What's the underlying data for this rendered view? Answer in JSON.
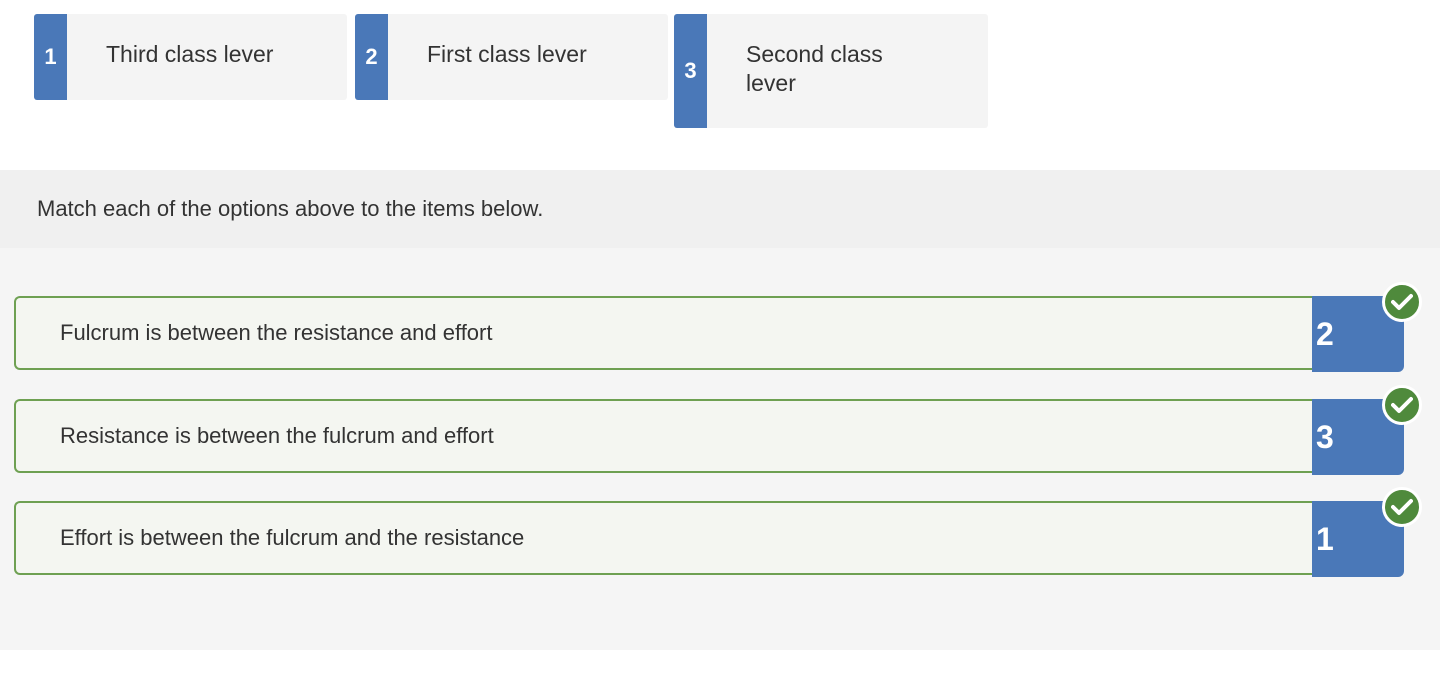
{
  "options": [
    {
      "number": "1",
      "label": "Third class lever"
    },
    {
      "number": "2",
      "label": "First class lever"
    },
    {
      "number": "3",
      "label": "Second class lever"
    }
  ],
  "instruction": "Match each of the options above to the items below.",
  "items": [
    {
      "label": "Fulcrum is between the resistance and effort",
      "answer": "2",
      "status": "correct"
    },
    {
      "label": "Resistance is between the fulcrum and effort",
      "answer": "3",
      "status": "correct"
    },
    {
      "label": "Effort is between the fulcrum and the resistance",
      "answer": "1",
      "status": "correct"
    }
  ],
  "colors": {
    "accent_blue": "#4a78b8",
    "correct_green": "#4f8a3c",
    "correct_border": "#6ea052"
  },
  "icons": {
    "correct": "check-circle-icon"
  }
}
